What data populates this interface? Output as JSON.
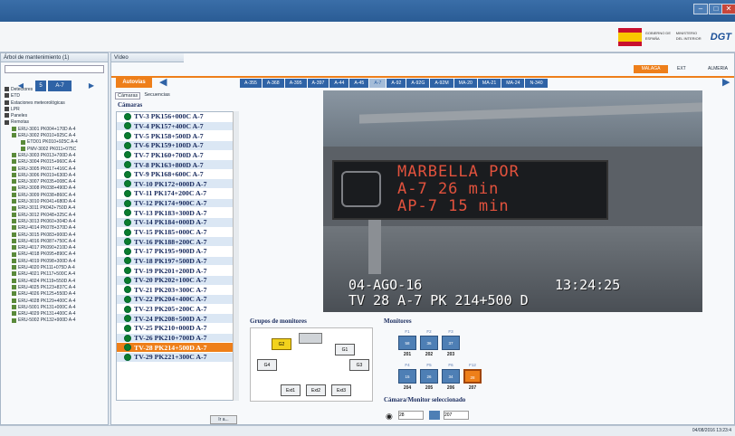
{
  "window": {
    "controls": [
      "–",
      "□",
      "✕"
    ]
  },
  "header": {
    "logos": [
      "GOBIERNO DE ESPAÑA",
      "MINISTERIO DEL INTERIOR",
      "DGT"
    ]
  },
  "tree_panel": {
    "title": "Árbol de mantenimiento (1)",
    "road_label": "A-7",
    "items": [
      "Detectores",
      "ETD",
      "Estaciones meteorológicas",
      "LPR",
      "Paneles",
      "Remotas",
      "ERU-3001 PK004+170D A-4",
      "ERU-3002 PK010+925C A-4",
      "ETD01 PK010+925C A-4",
      "PMV-3002 PK011+075C",
      "ERU-3003 PK013+700D A-4",
      "ERU-3004 PK015+960C A-4",
      "ERU-3005 PK017+416C A-4",
      "ERU-3006 PK019+630D A-4",
      "ERU-3007 PK035+008C A-4",
      "ERU-3008 PK038+490D A-4",
      "ERU-3009 PK038+860C A-4",
      "ERU-3010 PK041+680D A-4",
      "ERU-3011 PK042+750D A-4",
      "ERU-3012 PK048+325C A-4",
      "ERU-3013 PK060+304D A-4",
      "ERU-4014 PK078+370D A-4",
      "ERU-3015 PK083+900D A-4",
      "ERU-4016 PK087+750C A-4",
      "ERU-4017 PK090+210D A-4",
      "ERU-4018 PK095+890C A-4",
      "ERU-4019 PK098+300D A-4",
      "ERU-4020 PK111+075D A-4",
      "ERU-4021 PK117+500C A-4",
      "ERU-4024 PK119+550D A-4",
      "ERU-4025 PK123+837C A-4",
      "ERU-4026 PK125+550D A-4",
      "ERU-4028 PK129+400C A-4",
      "ERU-5001 PK131+000C A-4",
      "ERU-4029 PK131+400C A-4",
      "ERU-5002 PK132+900D A-4"
    ]
  },
  "video_panel": {
    "tab_title": "Vídeo",
    "autovia_btn": "Autovías",
    "region_tabs": [
      "MALAGA",
      "EXT",
      "ALMERIA"
    ],
    "roads": [
      "A-355",
      "A-368",
      "A-395",
      "A-397",
      "A-44",
      "A-45",
      "A-7",
      "A-92",
      "A-92G",
      "A-92M",
      "MA-20",
      "MA-21",
      "MA-24",
      "N-340"
    ],
    "selected_road": "A-7",
    "subtabs": [
      "Cámaras",
      "Secuencias"
    ],
    "cameras_title": "Cámaras",
    "cameras": [
      "TV-3 PK156+000C A-7",
      "TV-4 PK157+400C A-7",
      "TV-5 PK158+500D A-7",
      "TV-6 PK159+100D A-7",
      "TV-7 PK160+700D A-7",
      "TV-8 PK163+800D A-7",
      "TV-9 PK168+600C A-7",
      "TV-10 PK172+000D A-7",
      "TV-11 PK174+200C A-7",
      "TV-12 PK174+900C A-7",
      "TV-13 PK183+300D A-7",
      "TV-14 PK184+000D A-7",
      "TV-15 PK185+000C A-7",
      "TV-16 PK188+200C A-7",
      "TV-17 PK195+900D A-7",
      "TV-18 PK197+500D A-7",
      "TV-19 PK201+200D A-7",
      "TV-20 PK202+100C A-7",
      "TV-21 PK203+300C A-7",
      "TV-22 PK204+400C A-7",
      "TV-23 PK205+200C A-7",
      "TV-24 PK208+500D A-7",
      "TV-25 PK210+000D A-7",
      "TV-26 PK210+700D A-7",
      "TV-28 PK214+500D A-7",
      "TV-29 PK221+300C A-7"
    ],
    "selected_camera_index": 24,
    "video": {
      "sign_lines": [
        "MARBELLA POR",
        "A-7   26 min",
        "AP-7  15 min"
      ],
      "osd_date": "04-AGO-16",
      "osd_time": "13:24:25",
      "osd_cam": "TV 28 A-7 PK 214+500 D"
    },
    "monitor_groups": {
      "title": "Grupos de monitores",
      "buttons": [
        "G2",
        "G1",
        "G4",
        "G3",
        "Ext1",
        "Ext2",
        "Ext3"
      ]
    },
    "monitors": {
      "title": "Monitores",
      "row1": [
        {
          "top": "F1",
          "cam": "58",
          "num": "201"
        },
        {
          "top": "F2",
          "cam": "36",
          "num": "202"
        },
        {
          "top": "F3",
          "cam": "37",
          "num": "203"
        }
      ],
      "row2": [
        {
          "top": "F4",
          "cam": "15",
          "num": "204"
        },
        {
          "top": "F5",
          "cam": "26",
          "num": "205"
        },
        {
          "top": "F6",
          "cam": "34",
          "num": "206"
        },
        {
          "top": "F12",
          "cam": "28",
          "num": "207"
        }
      ]
    },
    "selection": {
      "title": "Cámara/Monitor seleccionado",
      "camera": "28",
      "monitor": "207"
    },
    "bottom_btn": "Ir a..."
  },
  "status": {
    "datetime": "04/08/2016 13:23:4"
  }
}
